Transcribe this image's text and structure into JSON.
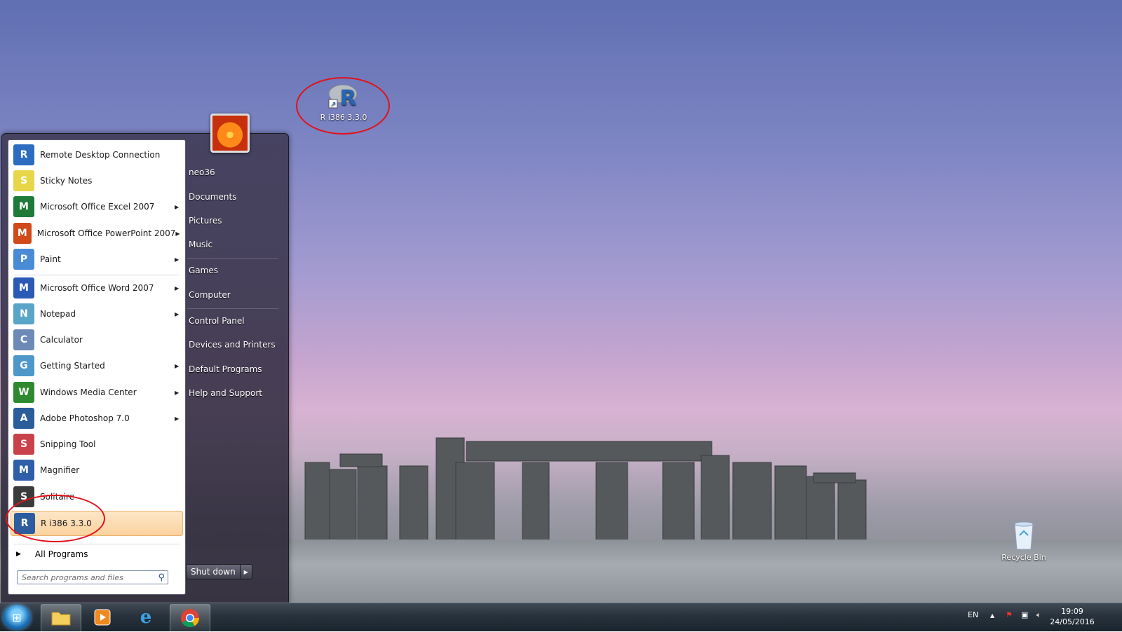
{
  "desktop": {
    "icons": [
      {
        "label": "R i386 3.3.0",
        "icon": "r-logo-icon"
      },
      {
        "label": "Recycle Bin",
        "icon": "recycle-bin-icon"
      }
    ]
  },
  "start_menu": {
    "programs": [
      {
        "label": "Remote Desktop Connection",
        "icon": "remote-desktop-icon",
        "submenu": false,
        "color": "#2d6cc0"
      },
      {
        "label": "Sticky Notes",
        "icon": "sticky-notes-icon",
        "submenu": false,
        "color": "#e8d64a"
      },
      {
        "label": "Microsoft Office Excel 2007",
        "icon": "excel-icon",
        "submenu": true,
        "color": "#1f7a3a"
      },
      {
        "label": "Microsoft Office PowerPoint 2007",
        "icon": "powerpoint-icon",
        "submenu": true,
        "color": "#d04a1c"
      },
      {
        "label": "Paint",
        "icon": "paint-icon",
        "submenu": true,
        "color": "#4a8bd6"
      },
      {
        "label": "Microsoft Office Word 2007",
        "icon": "word-icon",
        "submenu": true,
        "color": "#2a5ab5"
      },
      {
        "label": "Notepad",
        "icon": "notepad-icon",
        "submenu": true,
        "color": "#5aa4c8"
      },
      {
        "label": "Calculator",
        "icon": "calculator-icon",
        "submenu": false,
        "color": "#6c8ab5"
      },
      {
        "label": "Getting Started",
        "icon": "getting-started-icon",
        "submenu": true,
        "color": "#4e97c9"
      },
      {
        "label": "Windows Media Center",
        "icon": "media-center-icon",
        "submenu": true,
        "color": "#2f8a2f"
      },
      {
        "label": "Adobe Photoshop 7.0",
        "icon": "photoshop-icon",
        "submenu": true,
        "color": "#2c5c99"
      },
      {
        "label": "Snipping Tool",
        "icon": "snipping-tool-icon",
        "submenu": false,
        "color": "#c9414a"
      },
      {
        "label": "Magnifier",
        "icon": "magnifier-icon",
        "submenu": false,
        "color": "#2e5fa8"
      },
      {
        "label": "Solitaire",
        "icon": "solitaire-icon",
        "submenu": false,
        "color": "#3b3b3b"
      },
      {
        "label": "R i386 3.3.0",
        "icon": "r-logo-icon",
        "submenu": false,
        "color": "#2e5d9f"
      }
    ],
    "all_programs_label": "All Programs",
    "search_placeholder": "Search programs and files",
    "user_name": "neo36",
    "right_links": [
      "Documents",
      "Pictures",
      "Music",
      "Games",
      "Computer",
      "Control Panel",
      "Devices and Printers",
      "Default Programs",
      "Help and Support"
    ],
    "shutdown_label": "Shut down"
  },
  "taskbar": {
    "language": "EN",
    "time": "19:09",
    "date": "24/05/2016"
  },
  "colors": {
    "highlight": "#e0121b",
    "selected_item": "#fbd29e"
  }
}
